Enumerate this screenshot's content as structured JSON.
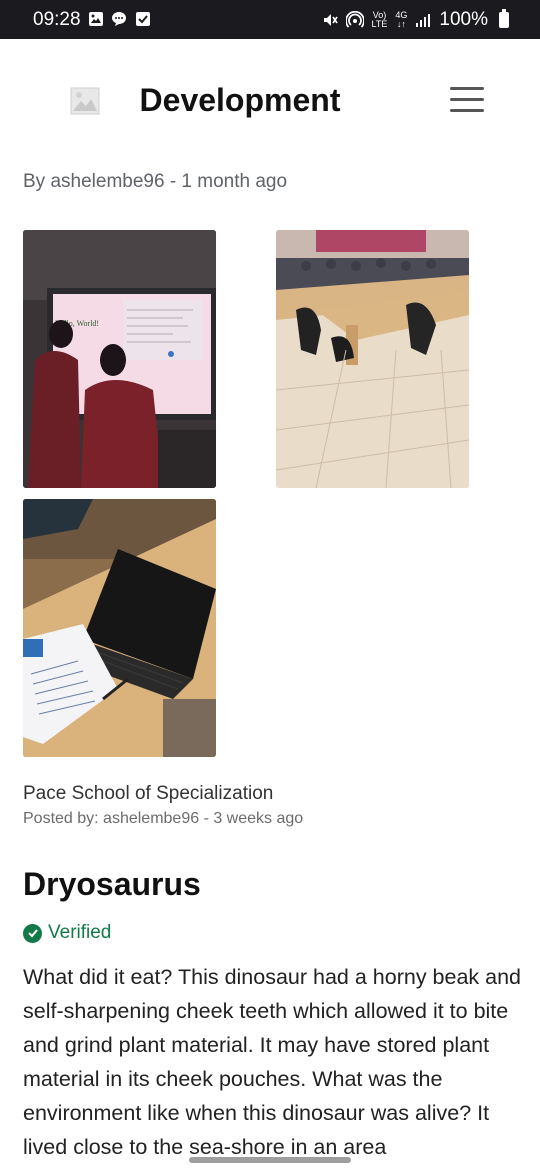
{
  "status_bar": {
    "time": "09:28",
    "network_top": "Vo)",
    "network_bottom": "LTE",
    "signal_gen": "4G",
    "battery": "100%"
  },
  "app_bar": {
    "title": "Development"
  },
  "byline": "By ashelembe96 - 1 month ago",
  "photos": {
    "p1_text": "Hello, World!"
  },
  "post": {
    "caption": "Pace School of Specialization",
    "posted_by": "Posted by: ashelembe96 - 3 weeks ago"
  },
  "article": {
    "title": "Dryosaurus",
    "verified_label": "Verified",
    "body": "What did it eat? This dinosaur had a horny beak and self-sharpening cheek teeth which allowed it to bite and grind plant material. It may have stored plant material in its cheek pouches. What was the environment like when this dinosaur was alive? It lived close to the sea-shore in an area"
  },
  "colors": {
    "status_bar_bg": "#1b1b1f",
    "verified_green": "#127a48",
    "text_dark": "#111111",
    "text_muted": "#5f6368"
  }
}
